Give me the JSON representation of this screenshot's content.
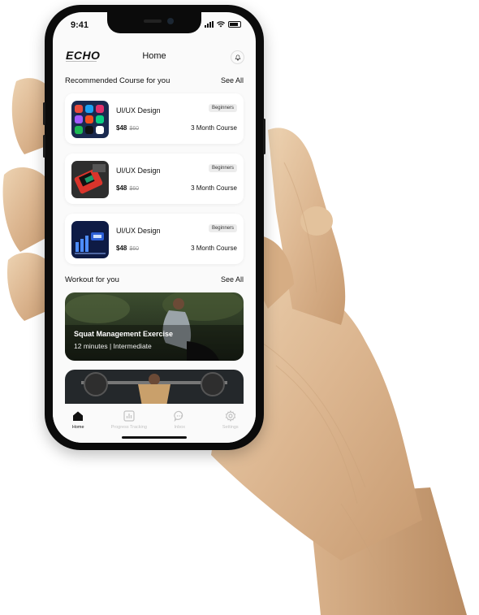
{
  "status": {
    "time": "9:41"
  },
  "header": {
    "logo": "ECHO",
    "title": "Home"
  },
  "recommended": {
    "title": "Recommended Course for you",
    "see_all": "See All",
    "courses": [
      {
        "name": "UI/UX Design",
        "price": "$48",
        "old_price": "$60",
        "level": "Beginners",
        "duration": "3 Month Course",
        "thumb_icon": "app-icons-collage"
      },
      {
        "name": "UI/UX Design",
        "price": "$48",
        "old_price": "$60",
        "level": "Beginners",
        "duration": "3 Month Course",
        "thumb_icon": "device-mockup"
      },
      {
        "name": "UI/UX Design",
        "price": "$48",
        "old_price": "$60",
        "level": "Beginners",
        "duration": "3 Month Course",
        "thumb_icon": "seo-analytics"
      }
    ]
  },
  "workout": {
    "title": "Workout for you",
    "see_all": "See All",
    "items": [
      {
        "title": "Squat Management Exercise",
        "subtitle": "12 minutes | Intermediate"
      },
      {
        "title": "",
        "subtitle": ""
      }
    ]
  },
  "nav": [
    {
      "label": "Home",
      "icon": "home-icon",
      "active": true
    },
    {
      "label": "Progress Tracking",
      "icon": "chart-icon",
      "active": false
    },
    {
      "label": "Inbox",
      "icon": "chat-icon",
      "active": false
    },
    {
      "label": "Settings",
      "icon": "gear-icon",
      "active": false
    }
  ],
  "colors": {
    "accent": "#111111",
    "inactive": "#c2c2c2",
    "wood": "#dcb690"
  }
}
